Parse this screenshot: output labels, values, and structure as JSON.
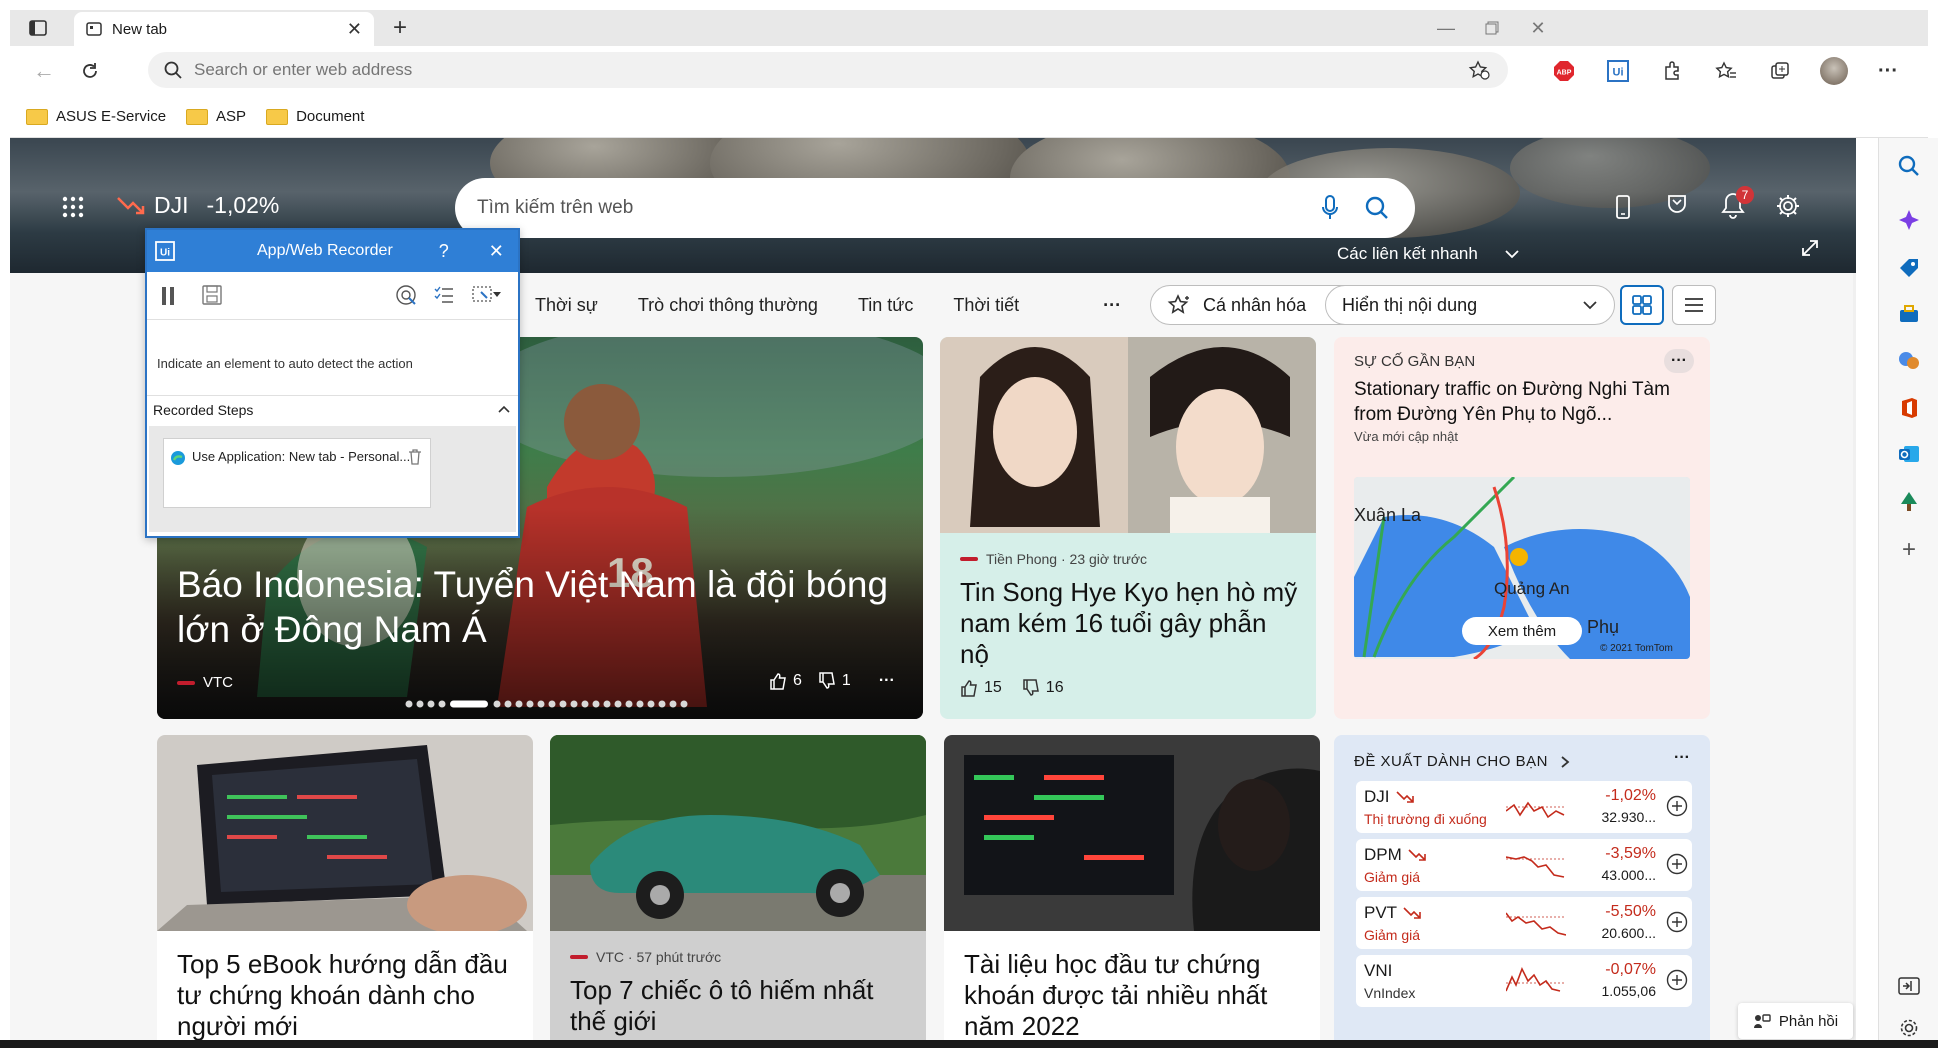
{
  "browser": {
    "tab_title": "New tab",
    "address_placeholder": "Search or enter web address",
    "bookmarks": [
      {
        "label": "ASUS E-Service"
      },
      {
        "label": "ASP"
      },
      {
        "label": "Document"
      }
    ]
  },
  "hero": {
    "ticker_symbol": "DJI",
    "ticker_change": "-1,02%",
    "search_placeholder": "Tìm kiếm trên web",
    "notification_count": "7",
    "quick_links_label": "Các liên kết nhanh"
  },
  "nav": {
    "items": [
      "Thời sự",
      "Trò chơi thông thường",
      "Tin tức",
      "Thời tiết"
    ],
    "more": "···",
    "personalize_label": "Cá nhân hóa",
    "content_select": "Hiển thị nội dung"
  },
  "featured": {
    "headline": "Báo Indonesia: Tuyển Việt Nam là đội bóng lớn ở Đông Nam Á",
    "source": "VTC",
    "likes": "6",
    "dislikes": "1",
    "more": "···"
  },
  "card_celeb": {
    "source": "Tiền Phong · 23 giờ trước",
    "headline": "Tin Song Hye Kyo hẹn hò mỹ nam kém 16 tuổi gây phẫn nộ",
    "likes": "15",
    "dislikes": "16"
  },
  "traffic": {
    "heading": "SỰ CỐ GẦN BẠN",
    "title": "Stationary traffic on Đường Nghi Tàm from Đường Yên Phụ to Ngõ...",
    "updated": "Vừa mới cập nhật",
    "map_labels": [
      "Xuân La",
      "Quảng An",
      "Yên Phụ"
    ],
    "map_credit": "© 2021 TomTom",
    "see_more": "Xem thêm",
    "more": "···"
  },
  "cards_bottom": [
    {
      "headline": "Top 5 eBook hướng dẫn đầu tư chứng khoán dành cho người mới"
    },
    {
      "source": "VTC · 57 phút trước",
      "headline": "Top 7 chiếc ô tô hiếm nhất thế giới"
    },
    {
      "headline": "Tài liệu học đầu tư chứng khoán được tải nhiều nhất năm 2022"
    }
  ],
  "stocks": {
    "heading": "ĐỀ XUẤT DÀNH CHO BẠN",
    "more": "···",
    "items": [
      {
        "symbol": "DJI",
        "desc": "Thị trường đi xuống",
        "change": "-1,02%",
        "price": "32.930...",
        "color": "#c42b1c"
      },
      {
        "symbol": "DPM",
        "desc": "Giảm giá",
        "change": "-3,59%",
        "price": "43.000...",
        "color": "#c42b1c"
      },
      {
        "symbol": "PVT",
        "desc": "Giảm giá",
        "change": "-5,50%",
        "price": "20.600...",
        "color": "#c42b1c"
      },
      {
        "symbol": "VNI",
        "desc": "VnIndex",
        "change": "-0,07%",
        "price": "1.055,06",
        "color": "#c42b1c"
      }
    ]
  },
  "feedback": {
    "label": "Phản hồi"
  },
  "recorder": {
    "title": "App/Web Recorder",
    "help": "?",
    "instruction": "Indicate an element to auto detect the action",
    "steps_label": "Recorded Steps",
    "step_item": "Use Application: New tab - Personal..."
  }
}
